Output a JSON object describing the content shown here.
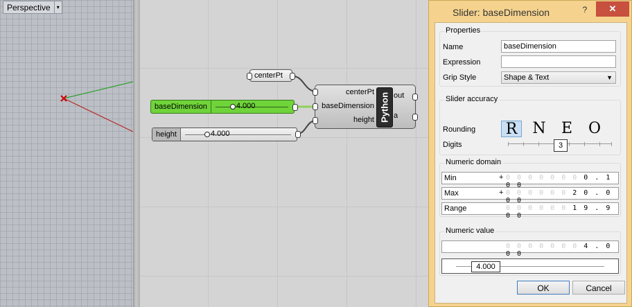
{
  "viewport": {
    "tab_label": "Perspective",
    "dropdown_glyph": "▾"
  },
  "canvas": {
    "centerpt_param": "centerPt",
    "base_slider": {
      "name": "baseDimension",
      "value": "4.000",
      "color": "#6fd33a"
    },
    "height_slider": {
      "name": "height",
      "value": "4.000"
    },
    "python_component": {
      "inputs": [
        "centerPt",
        "baseDimension",
        "height"
      ],
      "outputs": [
        "out",
        "a"
      ],
      "core_label": "Python"
    }
  },
  "dialog": {
    "title": "Slider: baseDimension",
    "help_glyph": "?",
    "close_glyph": "✕",
    "properties": {
      "title": "Properties",
      "name_label": "Name",
      "name_value": "baseDimension",
      "expression_label": "Expression",
      "expression_value": "",
      "grip_label": "Grip Style",
      "grip_value": "Shape & Text"
    },
    "accuracy": {
      "title": "Slider accuracy",
      "rounding_label": "Rounding",
      "rounding_options": [
        "R",
        "N",
        "E",
        "O"
      ],
      "rounding_selected": "R",
      "digits_label": "Digits",
      "digits_value": "3"
    },
    "domain": {
      "title": "Numeric domain",
      "min_label": "Min",
      "min_sign": "+",
      "min_faded": "0 0 0 0 0 0 0 ",
      "min_digits": "0 . 1 0 0",
      "max_label": "Max",
      "max_sign": "+",
      "max_faded": "0 0 0 0 0 0 ",
      "max_digits": "2 0 . 0 0 0",
      "range_label": "Range",
      "range_faded": "0 0 0 0 0 0 ",
      "range_digits": "1 9 . 9 0 0"
    },
    "value": {
      "title": "Numeric value",
      "faded": "0 0 0 0 0 0 0 ",
      "digits": "4 . 0 0 0",
      "slider_value": "4.000"
    },
    "ok_label": "OK",
    "cancel_label": "Cancel"
  }
}
